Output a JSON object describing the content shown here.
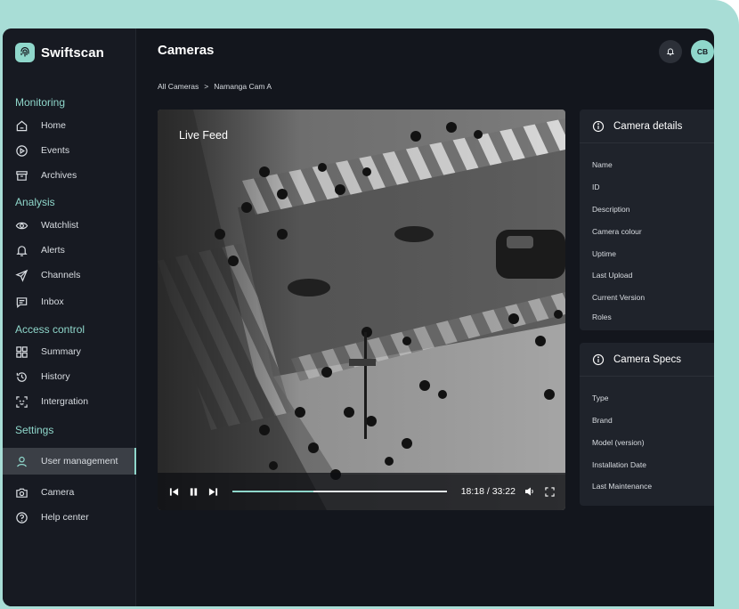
{
  "brand": {
    "name": "Swiftscan"
  },
  "sidebar": {
    "sections": [
      {
        "title": "Monitoring",
        "items": [
          {
            "label": "Home",
            "icon": "home-icon"
          },
          {
            "label": "Events",
            "icon": "play-circle-icon"
          },
          {
            "label": "Archives",
            "icon": "archive-icon"
          }
        ]
      },
      {
        "title": "Analysis",
        "items": [
          {
            "label": "Watchlist",
            "icon": "eye-icon"
          },
          {
            "label": "Alerts",
            "icon": "bell-icon"
          },
          {
            "label": "Channels",
            "icon": "send-icon"
          },
          {
            "label": "Inbox",
            "icon": "message-icon"
          }
        ]
      },
      {
        "title": "Access control",
        "items": [
          {
            "label": "Summary",
            "icon": "grid-icon"
          },
          {
            "label": "History",
            "icon": "history-icon"
          },
          {
            "label": "Intergration",
            "icon": "face-scan-icon"
          }
        ]
      },
      {
        "title": "Settings",
        "items": [
          {
            "label": "User management",
            "icon": "user-icon",
            "active": true
          },
          {
            "label": "Camera",
            "icon": "camera-icon"
          },
          {
            "label": "Help center",
            "icon": "help-icon"
          }
        ]
      }
    ]
  },
  "header": {
    "title": "Cameras",
    "avatar_initials": "CB"
  },
  "breadcrumb": {
    "root": "All Cameras",
    "separator": ">",
    "current": "Namanga Cam A"
  },
  "video": {
    "label": "Live Feed",
    "time": "18:18 / 33:22",
    "progress": 0.38
  },
  "camera_details": {
    "title": "Camera details",
    "rows": [
      "Name",
      "ID",
      "Description",
      "Camera colour",
      "Uptime",
      "Last Upload",
      "Current Version",
      "Roles"
    ]
  },
  "camera_specs": {
    "title": "Camera Specs",
    "rows": [
      "Type",
      "Brand",
      "Model (version)",
      "Installation Date",
      "Last Maintenance"
    ]
  },
  "colors": {
    "accent": "#8fd7cb",
    "background": "#13161d",
    "sidebar": "#171a22",
    "panel": "#1f232b"
  }
}
